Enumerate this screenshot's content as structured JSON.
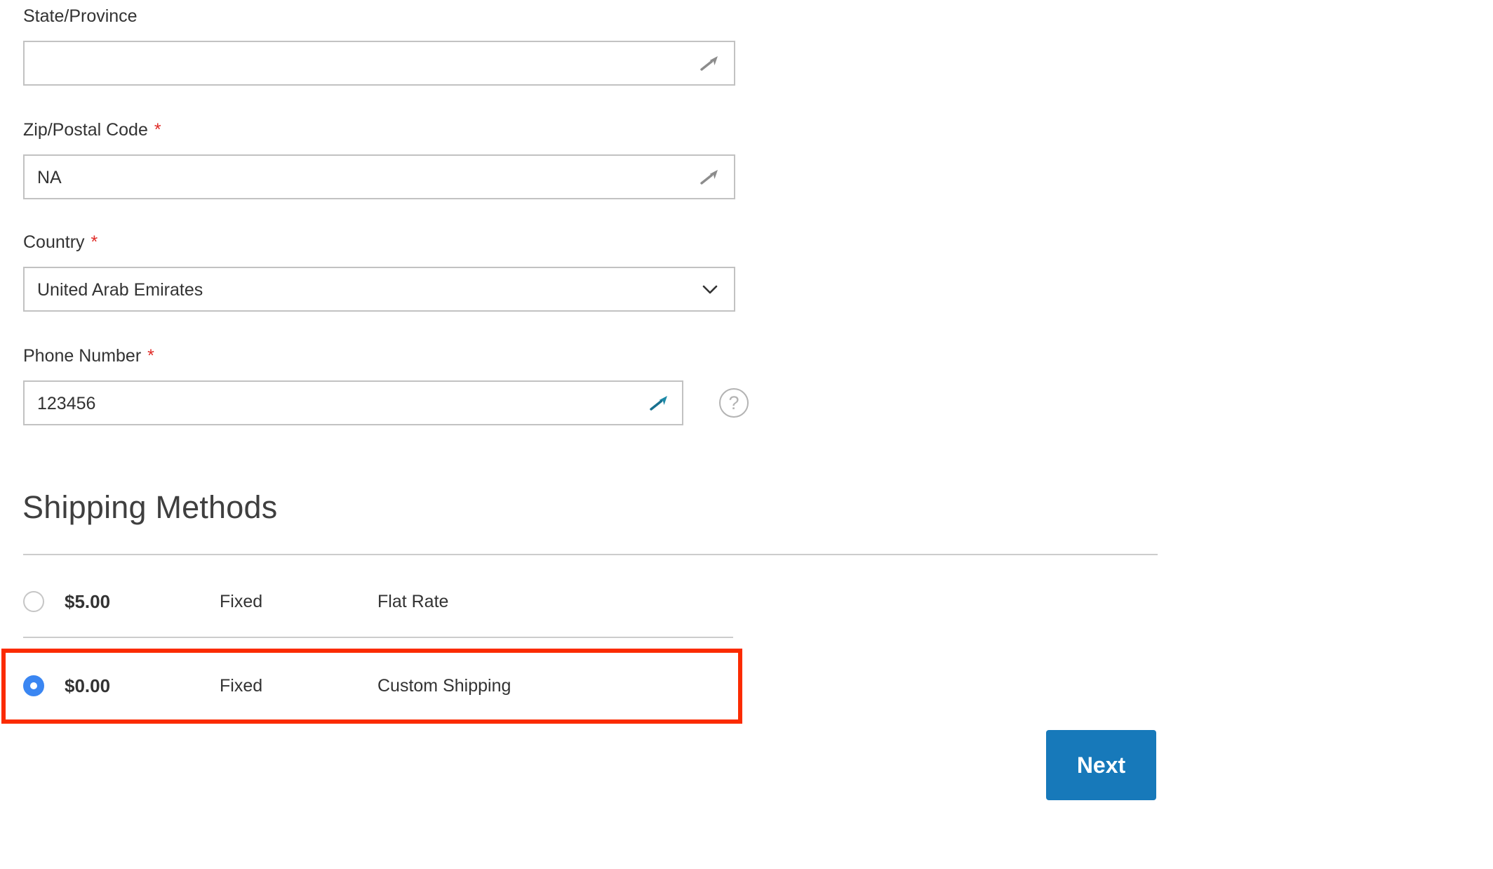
{
  "form": {
    "fields": [
      {
        "id": "state",
        "label": "State/Province",
        "required": false,
        "value": "",
        "placeholder": "",
        "type": "text",
        "icon": "wand-icon",
        "icon_color": "#8c8c8c"
      },
      {
        "id": "zip",
        "label": "Zip/Postal Code",
        "required": true,
        "required_mark": "*",
        "value": "NA",
        "placeholder": "",
        "type": "text",
        "icon": "wand-icon",
        "icon_color": "#8c8c8c"
      },
      {
        "id": "country",
        "label": "Country",
        "required": true,
        "required_mark": "*",
        "value": "United Arab Emirates",
        "type": "select",
        "icon": "chevron-down-icon"
      },
      {
        "id": "phone",
        "label": "Phone Number",
        "required": true,
        "required_mark": "*",
        "value": "123456",
        "placeholder": "",
        "type": "tel",
        "icon": "wand-icon",
        "icon_color": "#1878a0",
        "help": "?"
      }
    ]
  },
  "shipping": {
    "heading": "Shipping Methods",
    "methods": [
      {
        "price": "$5.00",
        "method_type": "Fixed",
        "carrier": "Flat Rate",
        "selected": false
      },
      {
        "price": "$0.00",
        "method_type": "Fixed",
        "carrier": "Custom Shipping",
        "selected": true
      }
    ]
  },
  "actions": {
    "next_label": "Next"
  },
  "annotation": {
    "highlight_color": "#fb2b00"
  },
  "colors": {
    "primary_button": "#1779ba",
    "radio_selected": "#3a86f2",
    "required_star": "#e02b27",
    "border": "#c2c2c2",
    "divider": "#cccccc"
  }
}
